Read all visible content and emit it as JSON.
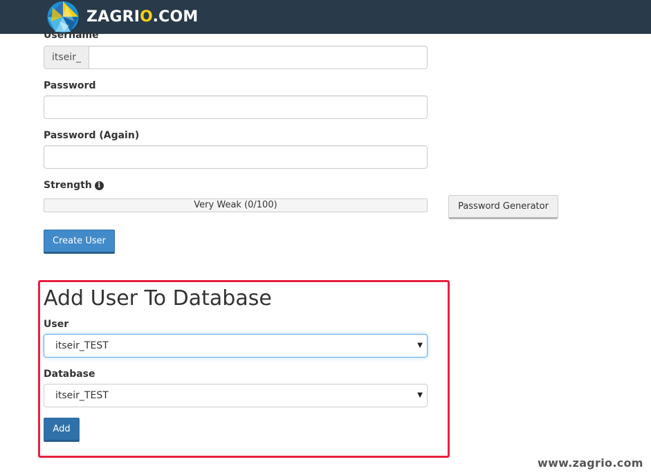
{
  "header": {
    "brand_prefix": "ZAGR",
    "brand_accent": "I",
    "brand_o": "O",
    "brand_suffix": ".COM",
    "accent_color": "#f5d00f",
    "bar_color": "#293a4a"
  },
  "create_user": {
    "username_label": "Username",
    "username_prefix": "itseir_",
    "username_value": "",
    "password_label": "Password",
    "password_value": "",
    "password_again_label": "Password (Again)",
    "password_again_value": "",
    "strength_label": "Strength",
    "strength_icon": "info-icon",
    "strength_text": "Very Weak (0/100)",
    "strength_score": 0,
    "password_generator_label": "Password Generator",
    "create_button_label": "Create User"
  },
  "add_user_to_db": {
    "title": "Add User To Database",
    "user_label": "User",
    "user_selected": "itseir_TEST",
    "database_label": "Database",
    "database_selected": "itseir_TEST",
    "add_button_label": "Add",
    "highlight_color": "#e8203f"
  },
  "watermark": "www.zagrio.com"
}
